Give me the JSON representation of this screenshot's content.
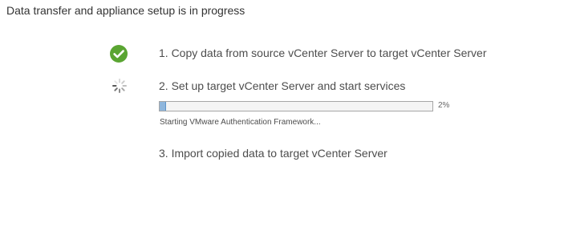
{
  "header": {
    "title": "Data transfer and appliance setup is in progress"
  },
  "steps": [
    {
      "label": "1. Copy data from source vCenter Server to target vCenter Server",
      "status": "completed",
      "icon": "check-circle-icon",
      "icon_color": "#5aa532"
    },
    {
      "label": "2. Set up target vCenter Server and start services",
      "status": "in-progress",
      "icon": "spinner-icon",
      "progress": {
        "percent_value": 0.02,
        "percent_label": "2%",
        "status_text": "Starting VMware Authentication Framework..."
      }
    },
    {
      "label": "3. Import copied data to target vCenter Server",
      "status": "pending"
    }
  ],
  "colors": {
    "success": "#5aa532",
    "progress_fill": "#8fb6dc",
    "text": "#333333"
  }
}
